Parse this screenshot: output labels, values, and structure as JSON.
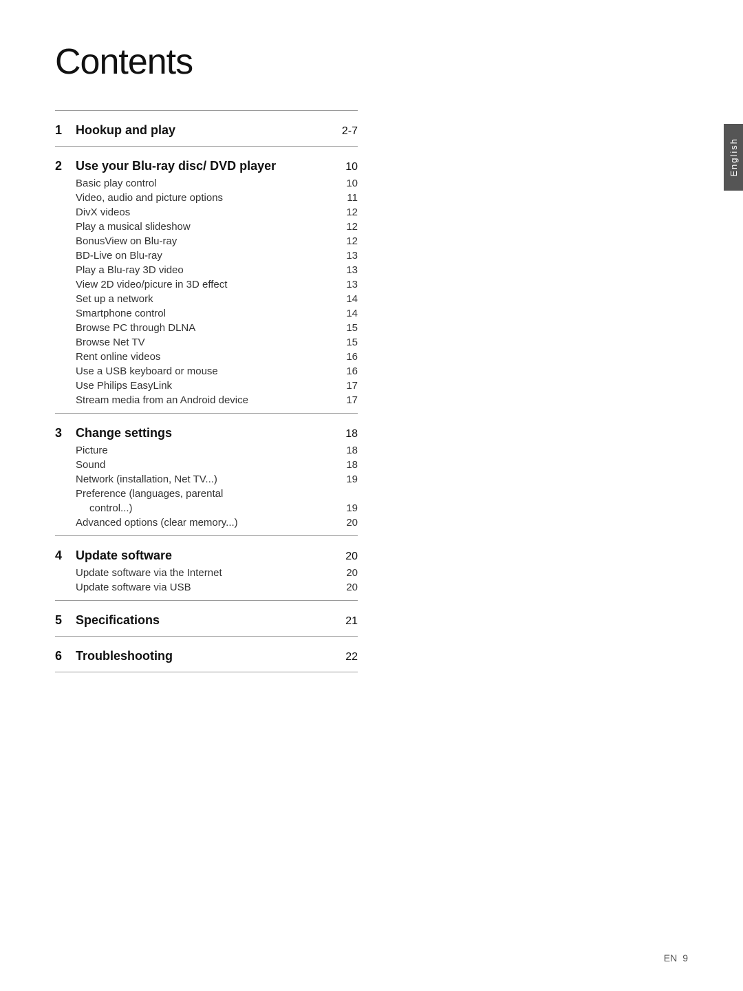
{
  "page": {
    "title": "Contents",
    "language_tab": "English",
    "bottom_lang": "EN",
    "bottom_page": "9"
  },
  "toc": [
    {
      "number": "1",
      "title": "Hookup and play",
      "page": "2-7",
      "sub_items": []
    },
    {
      "number": "2",
      "title": "Use your Blu-ray disc/ DVD player",
      "page": "10",
      "sub_items": [
        {
          "title": "Basic play control",
          "page": "10",
          "indent": false
        },
        {
          "title": "Video, audio and picture options",
          "page": "11",
          "indent": false
        },
        {
          "title": "DivX videos",
          "page": "12",
          "indent": false
        },
        {
          "title": "Play a musical slideshow",
          "page": "12",
          "indent": false
        },
        {
          "title": "BonusView on Blu-ray",
          "page": "12",
          "indent": false
        },
        {
          "title": "BD-Live on Blu-ray",
          "page": "13",
          "indent": false
        },
        {
          "title": "Play a Blu-ray 3D video",
          "page": "13",
          "indent": false
        },
        {
          "title": "View 2D video/picure in 3D effect",
          "page": "13",
          "indent": false
        },
        {
          "title": "Set up a network",
          "page": "14",
          "indent": false
        },
        {
          "title": "Smartphone control",
          "page": "14",
          "indent": false
        },
        {
          "title": "Browse PC through DLNA",
          "page": "15",
          "indent": false
        },
        {
          "title": "Browse Net TV",
          "page": "15",
          "indent": false
        },
        {
          "title": "Rent online videos",
          "page": "16",
          "indent": false
        },
        {
          "title": "Use a USB keyboard or mouse",
          "page": "16",
          "indent": false
        },
        {
          "title": "Use Philips EasyLink",
          "page": "17",
          "indent": false
        },
        {
          "title": "Stream media from an Android device",
          "page": "17",
          "indent": false
        }
      ]
    },
    {
      "number": "3",
      "title": "Change settings",
      "page": "18",
      "sub_items": [
        {
          "title": "Picture",
          "page": "18",
          "indent": false
        },
        {
          "title": "Sound",
          "page": "18",
          "indent": false
        },
        {
          "title": "Network (installation, Net TV...)",
          "page": "19",
          "indent": false
        },
        {
          "title": "Preference (languages, parental",
          "page": "",
          "indent": false
        },
        {
          "title": "control...)",
          "page": "19",
          "indent": true
        },
        {
          "title": "Advanced options (clear memory...)",
          "page": "20",
          "indent": false
        }
      ]
    },
    {
      "number": "4",
      "title": "Update software",
      "page": "20",
      "sub_items": [
        {
          "title": "Update software via the Internet",
          "page": "20",
          "indent": false
        },
        {
          "title": "Update software via USB",
          "page": "20",
          "indent": false
        }
      ]
    },
    {
      "number": "5",
      "title": "Specifications",
      "page": "21",
      "sub_items": []
    },
    {
      "number": "6",
      "title": "Troubleshooting",
      "page": "22",
      "sub_items": []
    }
  ]
}
